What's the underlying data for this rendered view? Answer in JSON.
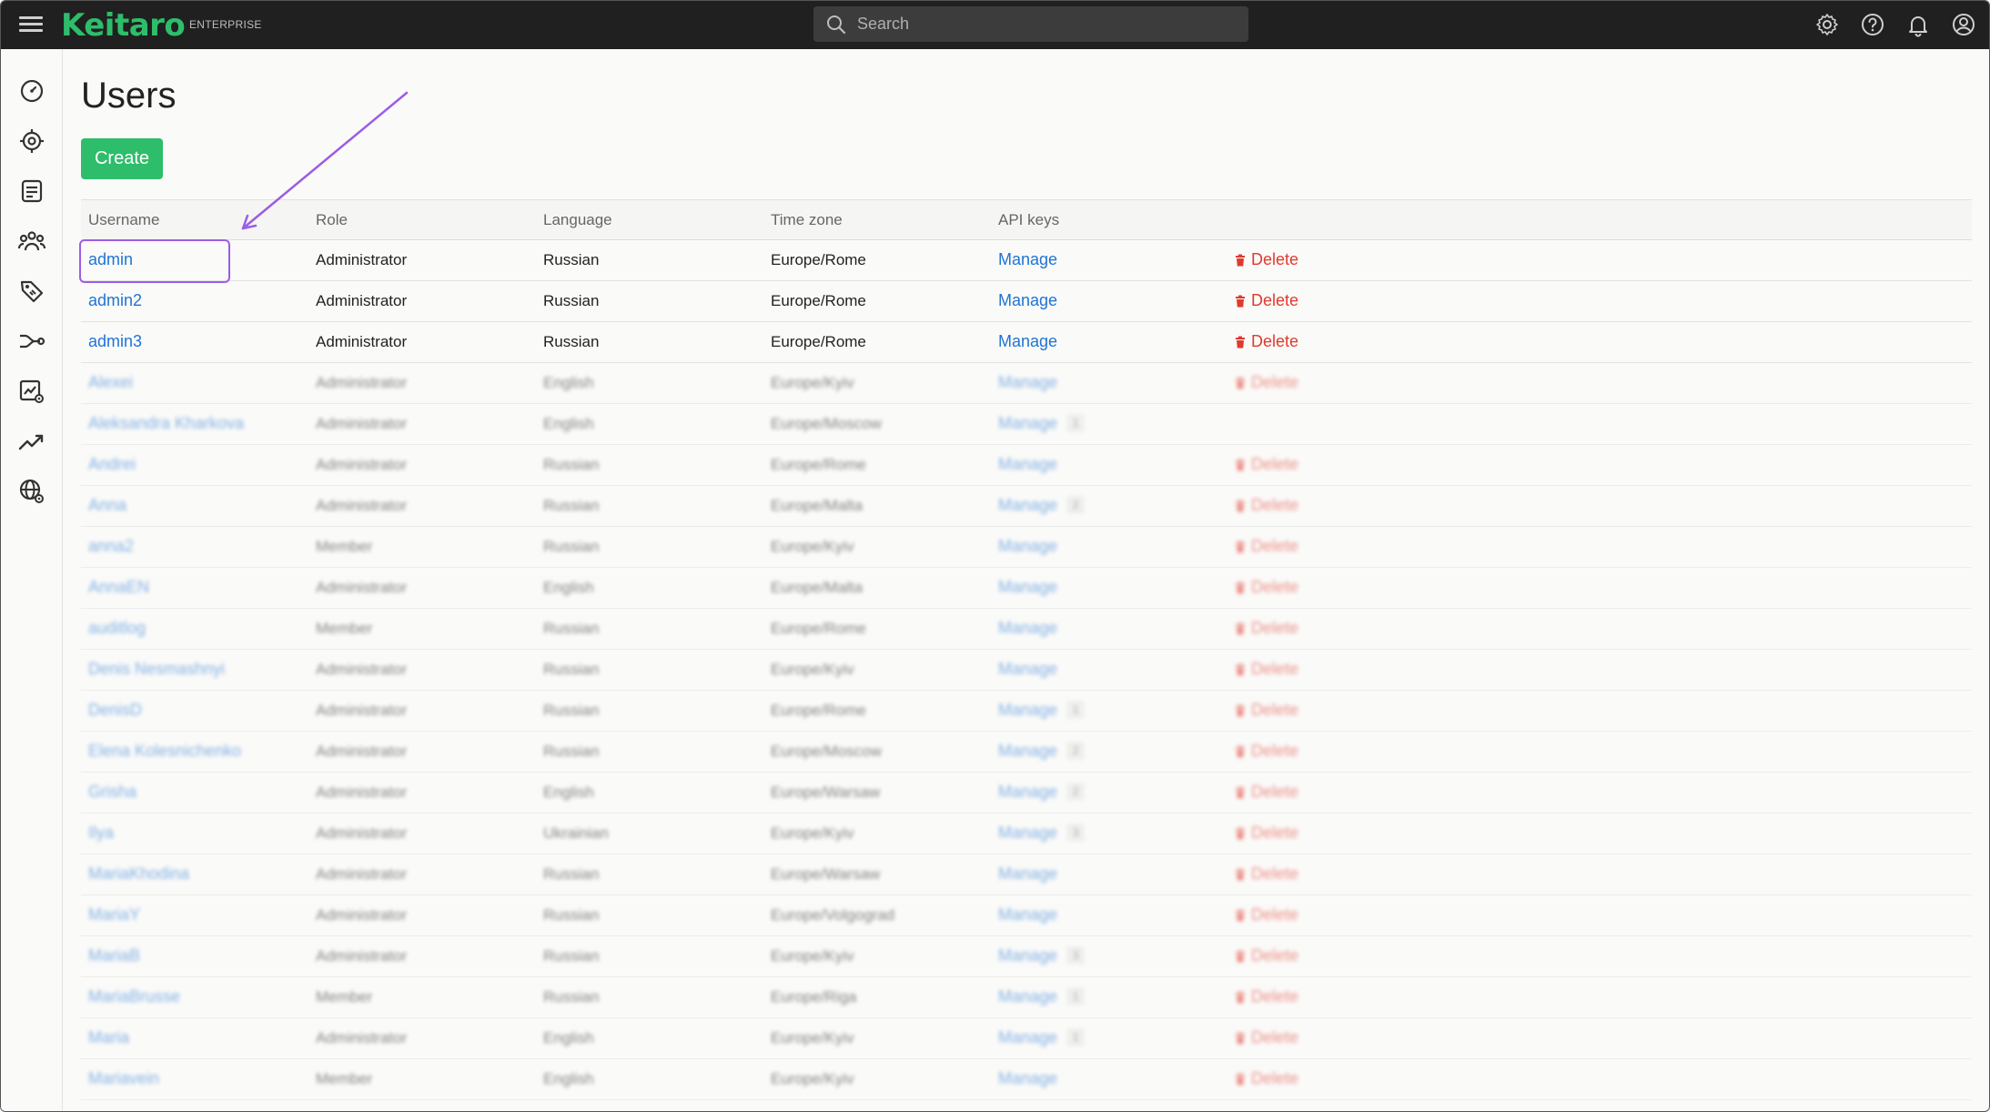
{
  "app": {
    "logo": "Keitaro",
    "edition": "ENTERPRISE",
    "search_placeholder": "Search"
  },
  "colors": {
    "brand": "#2ebd6b",
    "link": "#1f74d6",
    "danger": "#e03a2f",
    "annotation": "#9b5de5",
    "topbar": "#202020"
  },
  "topbar_icons": [
    "gear-icon",
    "help-icon",
    "bell-icon",
    "user-account-icon"
  ],
  "sidebar": {
    "items": [
      {
        "name": "dashboard-icon"
      },
      {
        "name": "campaigns-icon"
      },
      {
        "name": "offers-icon"
      },
      {
        "name": "affiliate-networks-icon"
      },
      {
        "name": "tags-icon"
      },
      {
        "name": "flows-icon"
      },
      {
        "name": "reports-settings-icon"
      },
      {
        "name": "trends-icon"
      },
      {
        "name": "domains-icon"
      }
    ]
  },
  "page": {
    "title": "Users",
    "create_label": "Create"
  },
  "table": {
    "columns": [
      "Username",
      "Role",
      "Language",
      "Time zone",
      "API keys",
      ""
    ],
    "manage_label": "Manage",
    "delete_label": "Delete",
    "rows": [
      {
        "username": "admin",
        "role": "Administrator",
        "language": "Russian",
        "timezone": "Europe/Rome",
        "api_count": "",
        "deletable": true,
        "blurred": false
      },
      {
        "username": "admin2",
        "role": "Administrator",
        "language": "Russian",
        "timezone": "Europe/Rome",
        "api_count": "",
        "deletable": true,
        "blurred": false
      },
      {
        "username": "admin3",
        "role": "Administrator",
        "language": "Russian",
        "timezone": "Europe/Rome",
        "api_count": "",
        "deletable": true,
        "blurred": false
      },
      {
        "username": "Alexei",
        "role": "Administrator",
        "language": "English",
        "timezone": "Europe/Kyiv",
        "api_count": "",
        "deletable": true,
        "blurred": true
      },
      {
        "username": "Aleksandra Kharkova",
        "role": "Administrator",
        "language": "English",
        "timezone": "Europe/Moscow",
        "api_count": "1",
        "deletable": false,
        "blurred": true
      },
      {
        "username": "Andrei",
        "role": "Administrator",
        "language": "Russian",
        "timezone": "Europe/Rome",
        "api_count": "",
        "deletable": true,
        "blurred": true
      },
      {
        "username": "Anna",
        "role": "Administrator",
        "language": "Russian",
        "timezone": "Europe/Malta",
        "api_count": "2",
        "deletable": true,
        "blurred": true
      },
      {
        "username": "anna2",
        "role": "Member",
        "language": "Russian",
        "timezone": "Europe/Kyiv",
        "api_count": "",
        "deletable": true,
        "blurred": true
      },
      {
        "username": "AnnaEN",
        "role": "Administrator",
        "language": "English",
        "timezone": "Europe/Malta",
        "api_count": "",
        "deletable": true,
        "blurred": true
      },
      {
        "username": "auditlog",
        "role": "Member",
        "language": "Russian",
        "timezone": "Europe/Rome",
        "api_count": "",
        "deletable": true,
        "blurred": true
      },
      {
        "username": "Denis Nesmashnyi",
        "role": "Administrator",
        "language": "Russian",
        "timezone": "Europe/Kyiv",
        "api_count": "",
        "deletable": true,
        "blurred": true
      },
      {
        "username": "DenisD",
        "role": "Administrator",
        "language": "Russian",
        "timezone": "Europe/Rome",
        "api_count": "1",
        "deletable": true,
        "blurred": true
      },
      {
        "username": "Elena Kolesnichenko",
        "role": "Administrator",
        "language": "Russian",
        "timezone": "Europe/Moscow",
        "api_count": "2",
        "deletable": true,
        "blurred": true
      },
      {
        "username": "Grisha",
        "role": "Administrator",
        "language": "English",
        "timezone": "Europe/Warsaw",
        "api_count": "2",
        "deletable": true,
        "blurred": true
      },
      {
        "username": "Ilya",
        "role": "Administrator",
        "language": "Ukrainian",
        "timezone": "Europe/Kyiv",
        "api_count": "3",
        "deletable": true,
        "blurred": true
      },
      {
        "username": "MariaKhodina",
        "role": "Administrator",
        "language": "Russian",
        "timezone": "Europe/Warsaw",
        "api_count": "",
        "deletable": true,
        "blurred": true
      },
      {
        "username": "MariaY",
        "role": "Administrator",
        "language": "Russian",
        "timezone": "Europe/Volgograd",
        "api_count": "",
        "deletable": true,
        "blurred": true
      },
      {
        "username": "MariaB",
        "role": "Administrator",
        "language": "Russian",
        "timezone": "Europe/Kyiv",
        "api_count": "3",
        "deletable": true,
        "blurred": true
      },
      {
        "username": "MariaBrusse",
        "role": "Member",
        "language": "Russian",
        "timezone": "Europe/Riga",
        "api_count": "1",
        "deletable": true,
        "blurred": true
      },
      {
        "username": "Maria",
        "role": "Administrator",
        "language": "English",
        "timezone": "Europe/Kyiv",
        "api_count": "1",
        "deletable": true,
        "blurred": true
      },
      {
        "username": "Mariavein",
        "role": "Member",
        "language": "English",
        "timezone": "Europe/Kyiv",
        "api_count": "",
        "deletable": true,
        "blurred": true
      }
    ]
  }
}
